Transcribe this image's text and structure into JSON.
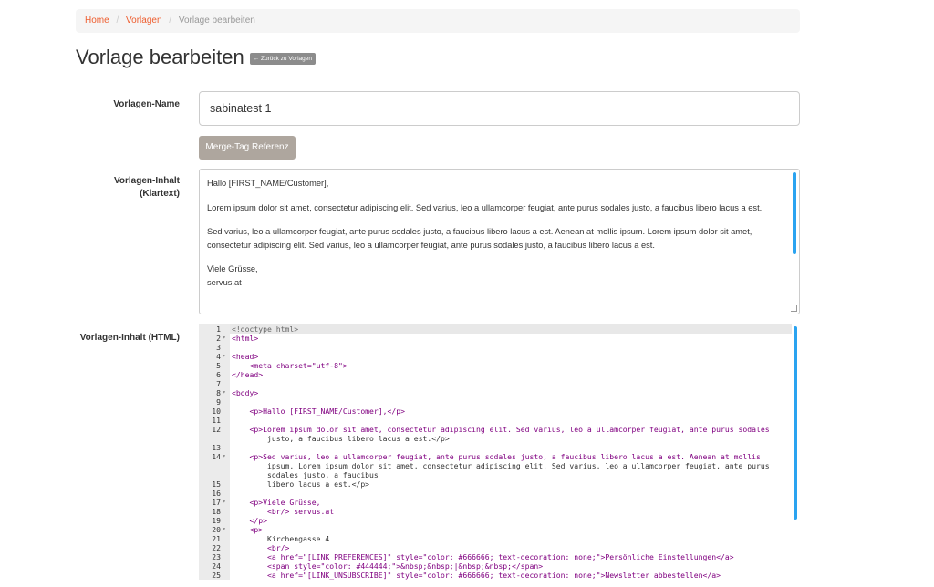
{
  "breadcrumb": {
    "home": "Home",
    "templates": "Vorlagen",
    "current": "Vorlage bearbeiten"
  },
  "header": {
    "title": "Vorlage bearbeiten",
    "back_label": "← Zurück zu Vorlagen"
  },
  "form": {
    "name_label": "Vorlagen-Name",
    "name_value": "sabinatest 1",
    "merge_tag_button": "Merge-Tag Referenz",
    "plain_label_line1": "Vorlagen-Inhalt",
    "plain_label_line2": "(Klartext)",
    "plain_paragraphs": [
      "Hallo [FIRST_NAME/Customer],",
      "Lorem ipsum dolor sit amet, consectetur adipiscing elit. Sed varius, leo a ullamcorper feugiat, ante purus sodales justo, a faucibus libero lacus a est.",
      "Sed varius, leo a ullamcorper feugiat, ante purus sodales justo, a faucibus libero lacus a est. Aenean at mollis ipsum. Lorem ipsum dolor sit amet, consectetur adipiscing elit. Sed varius, leo a ullamcorper feugiat, ante purus sodales justo, a faucibus libero lacus a est.",
      "Viele Grüsse,",
      "servus.at"
    ],
    "html_label": "Vorlagen-Inhalt (HTML)"
  },
  "editor": {
    "lines": [
      {
        "n": "1",
        "f": "",
        "t": "<!doctype html>"
      },
      {
        "n": "2",
        "f": "▾",
        "t": "<html>"
      },
      {
        "n": "3",
        "f": "",
        "t": ""
      },
      {
        "n": "4",
        "f": "▾",
        "t": "<head>"
      },
      {
        "n": "5",
        "f": "",
        "t": "    <meta charset=\"utf-8\">"
      },
      {
        "n": "6",
        "f": "",
        "t": "</head>"
      },
      {
        "n": "7",
        "f": "",
        "t": ""
      },
      {
        "n": "8",
        "f": "▾",
        "t": "<body>"
      },
      {
        "n": "9",
        "f": "",
        "t": ""
      },
      {
        "n": "10",
        "f": "",
        "t": "    <p>Hallo [FIRST_NAME/Customer],</p>"
      },
      {
        "n": "11",
        "f": "",
        "t": ""
      },
      {
        "n": "12",
        "f": "",
        "t": "    <p>Lorem ipsum dolor sit amet, consectetur adipiscing elit. Sed varius, leo a ullamcorper feugiat, ante purus sodales"
      },
      {
        "n": "",
        "f": "",
        "t": "        justo, a faucibus libero lacus a est.</p>"
      },
      {
        "n": "13",
        "f": "",
        "t": ""
      },
      {
        "n": "14",
        "f": "▾",
        "t": "    <p>Sed varius, leo a ullamcorper feugiat, ante purus sodales justo, a faucibus libero lacus a est. Aenean at mollis"
      },
      {
        "n": "",
        "f": "",
        "t": "        ipsum. Lorem ipsum dolor sit amet, consectetur adipiscing elit. Sed varius, leo a ullamcorper feugiat, ante purus"
      },
      {
        "n": "",
        "f": "",
        "t": "        sodales justo, a faucibus"
      },
      {
        "n": "15",
        "f": "",
        "t": "        libero lacus a est.</p>"
      },
      {
        "n": "16",
        "f": "",
        "t": ""
      },
      {
        "n": "17",
        "f": "▾",
        "t": "    <p>Viele Grüsse,"
      },
      {
        "n": "18",
        "f": "",
        "t": "        <br/> servus.at"
      },
      {
        "n": "19",
        "f": "",
        "t": "    </p>"
      },
      {
        "n": "20",
        "f": "▾",
        "t": "    <p>"
      },
      {
        "n": "21",
        "f": "",
        "t": "        Kirchengasse 4"
      },
      {
        "n": "22",
        "f": "",
        "t": "        <br/>"
      },
      {
        "n": "23",
        "f": "",
        "t": "        <a href=\"[LINK_PREFERENCES]\" style=\"color: #666666; text-decoration: none;\">Persönliche Einstellungen</a>"
      },
      {
        "n": "24",
        "f": "",
        "t": "        <span style=\"color: #444444;\">&nbsp;&nbsp;|&nbsp;&nbsp;</span>"
      },
      {
        "n": "25",
        "f": "",
        "t": "        <a href=\"[LINK_UNSUBSCRIBE]\" style=\"color: #666666; text-decoration: none;\">Newsletter abbestellen</a>"
      }
    ]
  },
  "colors": {
    "link": "#ee5d2e",
    "button": "#aea69e",
    "scrollbar": "#2aa3f0",
    "badge": "#8c8c8c"
  }
}
